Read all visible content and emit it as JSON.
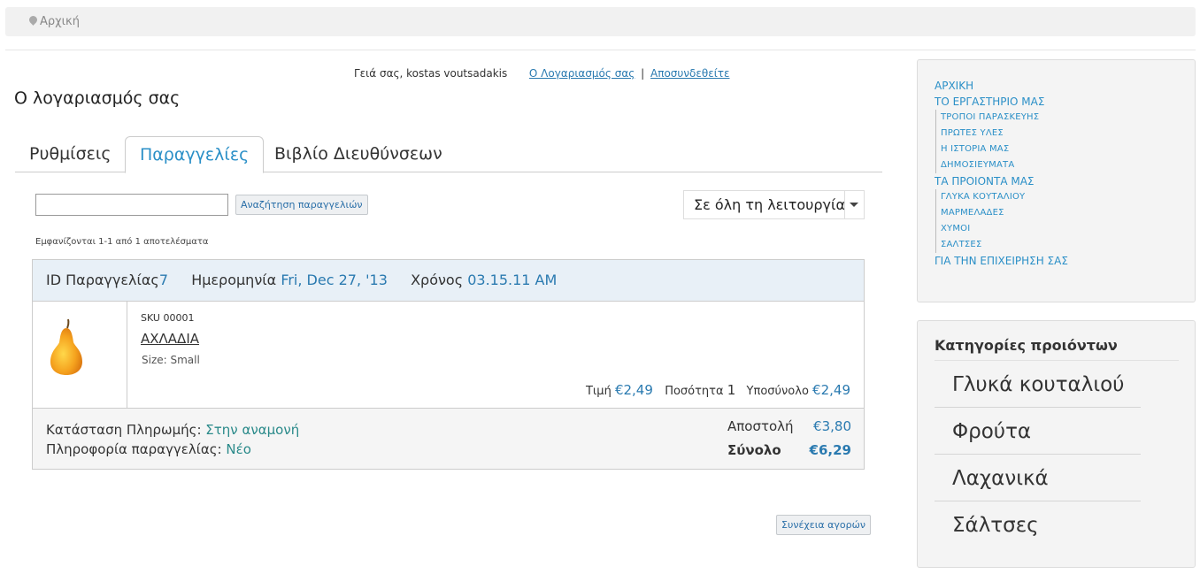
{
  "breadcrumb": {
    "home": "Αρχική"
  },
  "greeting": {
    "text": "Γειά σας, kostas voutsadakis",
    "account_link": "Ο Λογαριασμός σας",
    "separator": "|",
    "logout_link": "Αποσυνδεθείτε"
  },
  "page_title": "Ο λογαριασμός σας",
  "tabs": [
    {
      "label": "Ρυθμίσεις",
      "active": false
    },
    {
      "label": "Παραγγελίες",
      "active": true
    },
    {
      "label": "Βιβλίο Διευθύνσεων",
      "active": false
    }
  ],
  "search": {
    "value": "",
    "button": "Αναζήτηση παραγγελιών"
  },
  "filter": {
    "selected": "Σε όλη τη λειτουργία"
  },
  "results_text": "Εμφανίζονται 1-1 από 1 αποτελέσματα",
  "order": {
    "id_label": "ID Παραγγελίας",
    "id": "7",
    "date_label": "Ημερομηνία",
    "date": "Fri, Dec 27, '13",
    "time_label": "Χρόνος",
    "time": "03.15.11 AM",
    "item": {
      "image_icon": "pear-image",
      "sku": "SKU 00001",
      "name": "ΑΧΛΑΔΙΑ",
      "size": "Size: Small",
      "price_label": "Τιμή",
      "price": "€2,49",
      "qty_label": "Ποσότητα",
      "qty": "1",
      "subtotal_label": "Υποσύνολο",
      "subtotal": "€2,49"
    },
    "payment_label": "Κατάσταση Πληρωμής:",
    "payment_status": "Στην αναμονή",
    "info_label": "Πληροφορία παραγγελίας:",
    "info_status": "Νέο",
    "shipping_label": "Αποστολή",
    "shipping": "€3,80",
    "total_label": "Σύνολο",
    "total": "€6,29"
  },
  "continue_button": "Συνέχεια αγορών",
  "side_menu": {
    "items": [
      {
        "label": "ΑΡΧΙΚΗ"
      },
      {
        "label": "ΤΟ ΕΡΓΑΣΤΗΡΙΟ ΜΑΣ",
        "children": [
          "ΤΡΟΠΟΙ ΠΑΡΑΣΚΕΥΗΣ",
          "ΠΡΩΤΕΣ ΥΛΕΣ",
          "Η ΙΣΤΟΡΙΑ ΜΑΣ",
          "ΔΗΜΟΣΙΕΥΜΑΤΑ"
        ]
      },
      {
        "label": "ΤΑ ΠΡΟΙΟΝΤΑ ΜΑΣ",
        "children": [
          "ΓΛΥΚΑ ΚΟΥΤΑΛΙΟΥ",
          "ΜΑΡΜΕΛΑΔΕΣ",
          "ΧΥΜΟΙ",
          "ΣΑΛΤΣΕΣ"
        ]
      },
      {
        "label": "ΓΙΑ ΤΗΝ ΕΠΙΧΕΙΡΗΣΗ ΣΑΣ"
      }
    ]
  },
  "categories": {
    "title": "Κατηγορίες προιόντων",
    "items": [
      "Γλυκά κουταλιού",
      "Φρούτα",
      "Λαχανικά",
      "Σάλτσες"
    ]
  }
}
